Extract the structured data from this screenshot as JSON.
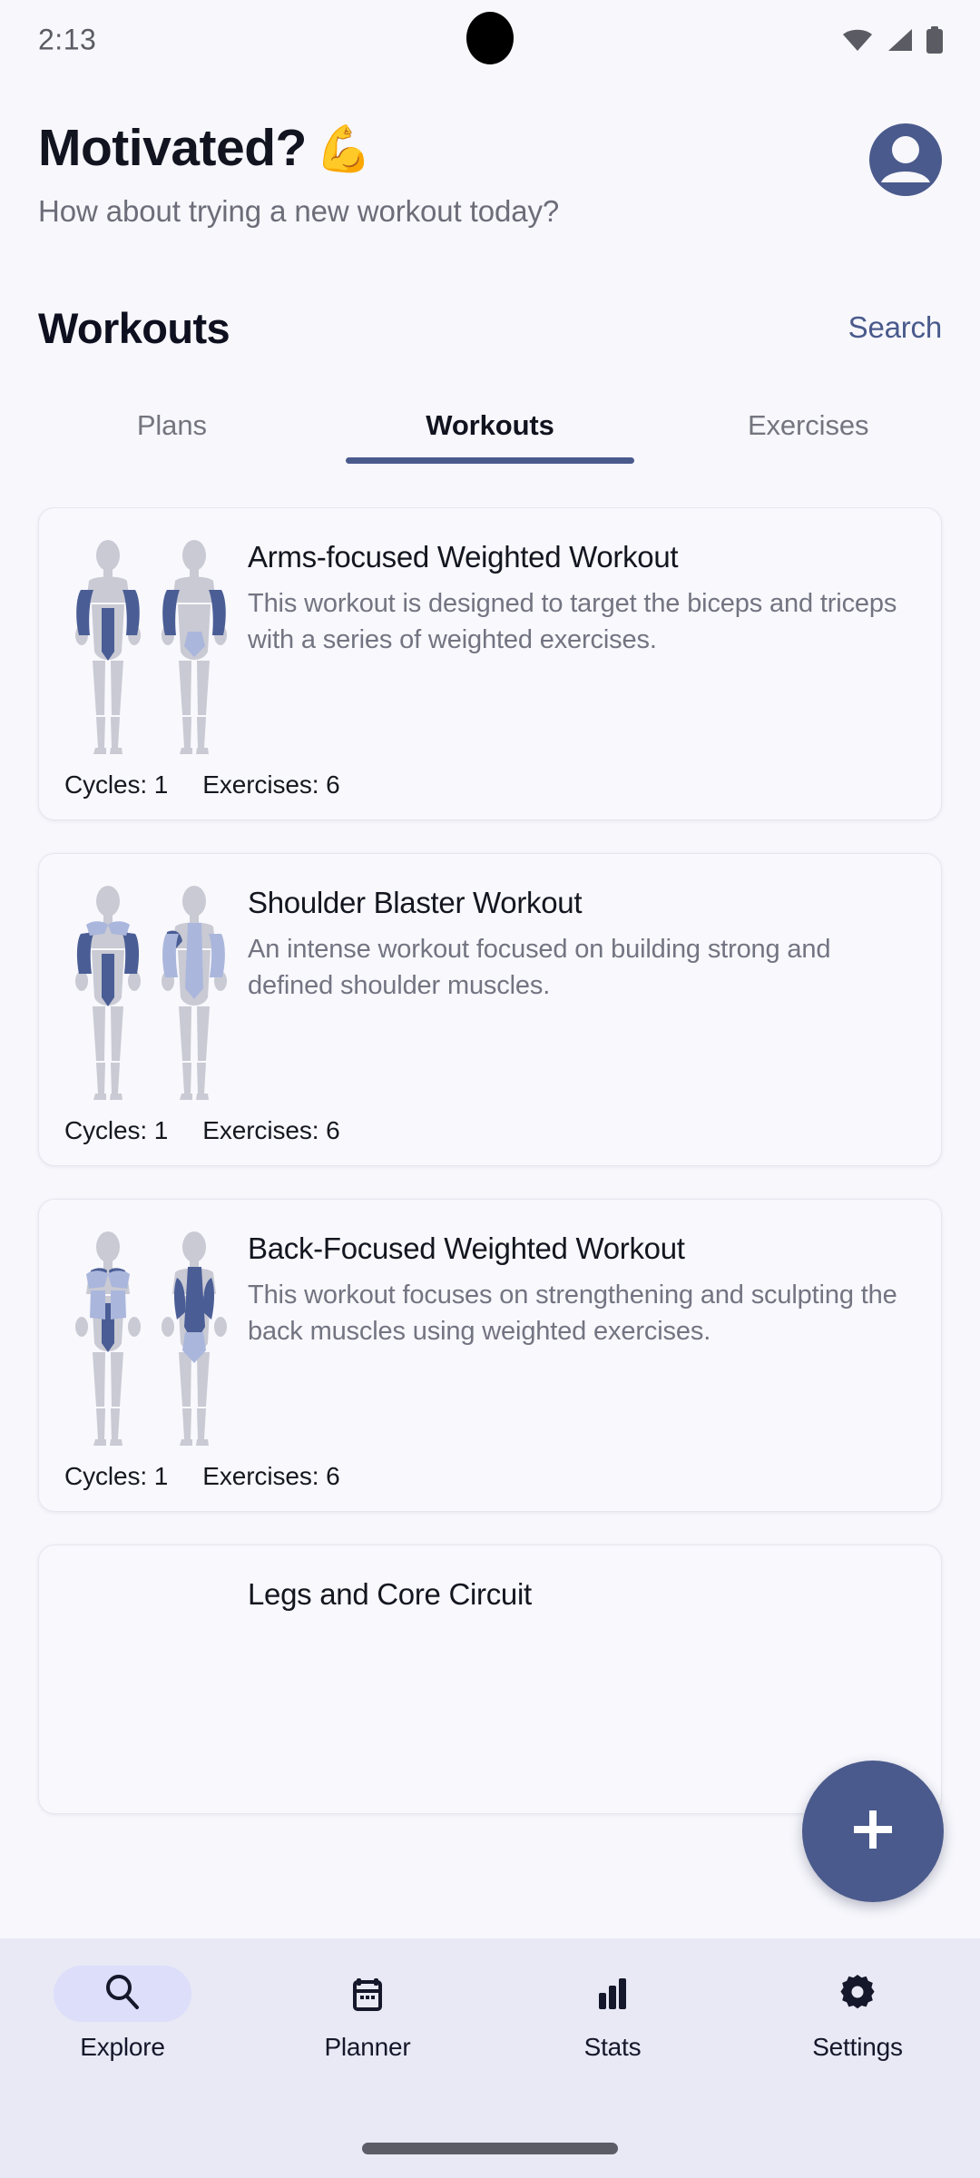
{
  "status_bar": {
    "time": "2:13",
    "icons": [
      "wifi-icon",
      "cellular-signal-icon",
      "battery-icon"
    ]
  },
  "header": {
    "greeting": "Motivated?",
    "greeting_emoji": "💪",
    "subtitle": "How about trying a new workout today?",
    "avatar_icon": "account-circle-icon"
  },
  "section": {
    "title": "Workouts",
    "search_label": "Search"
  },
  "tabs": [
    {
      "label": "Plans",
      "active": false
    },
    {
      "label": "Workouts",
      "active": true
    },
    {
      "label": "Exercises",
      "active": false
    }
  ],
  "workouts": [
    {
      "title": "Arms-focused Weighted Workout",
      "description": "This workout is designed to target the biceps and triceps with a series of weighted exercises.",
      "cycles_label": "Cycles: 1",
      "exercises_label": "Exercises: 6",
      "highlight": "arms"
    },
    {
      "title": "Shoulder Blaster Workout",
      "description": "An intense workout focused on building strong and defined shoulder muscles.",
      "cycles_label": "Cycles: 1",
      "exercises_label": "Exercises: 6",
      "highlight": "shoulders"
    },
    {
      "title": "Back-Focused Weighted Workout",
      "description": "This workout focuses on strengthening and sculpting the back muscles using weighted exercises.",
      "cycles_label": "Cycles: 1",
      "exercises_label": "Exercises: 6",
      "highlight": "back"
    },
    {
      "title": "Legs and Core Circuit",
      "description": "",
      "cycles_label": "",
      "exercises_label": "",
      "highlight": "legs"
    }
  ],
  "fab": {
    "icon": "plus-icon",
    "label": "Add workout"
  },
  "bottom_nav": [
    {
      "label": "Explore",
      "icon": "search-icon",
      "active": true
    },
    {
      "label": "Planner",
      "icon": "calendar-icon",
      "active": false
    },
    {
      "label": "Stats",
      "icon": "bar-chart-icon",
      "active": false
    },
    {
      "label": "Settings",
      "icon": "gear-icon",
      "active": false
    }
  ],
  "colors": {
    "accent": "#4a5a8c",
    "muscle_primary": "#4a5d95",
    "muscle_secondary": "#aab6dc",
    "body_base": "#c9cad3",
    "background": "#f7f7fc",
    "nav_background": "#e8e9f5",
    "nav_active_pill": "#dcdefa"
  }
}
